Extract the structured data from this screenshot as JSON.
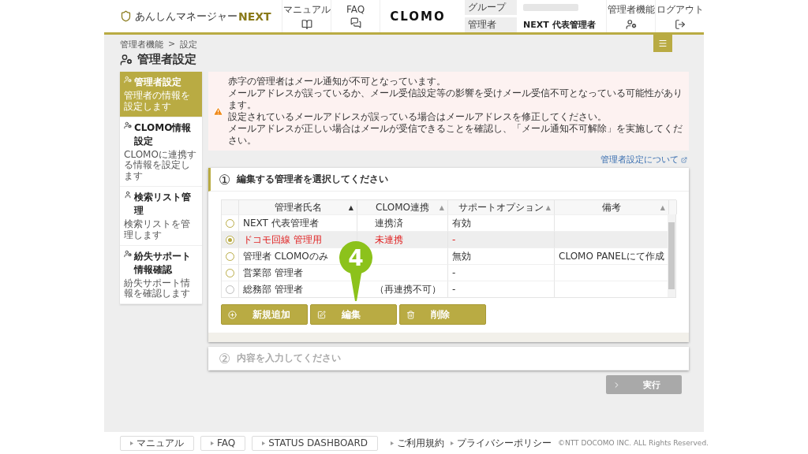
{
  "header": {
    "logo_text": "あんしんマネージャー",
    "logo_accent": "NEXT",
    "nav": [
      {
        "kind": "book",
        "label": "マニュアル"
      },
      {
        "kind": "faq",
        "label": "FAQ"
      }
    ],
    "brand_logo": "CLOMO",
    "account": {
      "group_label": "グループ",
      "admin_label": "管理者",
      "admin_name": "NEXT 代表管理者"
    },
    "actions": [
      {
        "kind": "admin",
        "label": "管理者機能"
      },
      {
        "kind": "logout",
        "label": "ログアウト"
      }
    ]
  },
  "breadcrumb": {
    "items": [
      "管理者機能",
      "設定"
    ],
    "separator": ">"
  },
  "page_title": "管理者設定",
  "sidebar": {
    "items": [
      {
        "kind": "admin",
        "title": "管理者設定",
        "desc": "管理者の情報を設定します",
        "selected": true
      },
      {
        "kind": "admin",
        "title": "CLOMO情報設定",
        "desc": "CLOMOに連携する情報を設定します",
        "selected": false
      },
      {
        "kind": "user",
        "title": "検索リスト管理",
        "desc": "検索リストを管理します",
        "selected": false
      },
      {
        "kind": "admin",
        "title": "紛失サポート情報確認",
        "desc": "紛失サポート情報を確認します",
        "selected": false
      }
    ]
  },
  "alert": {
    "lines": [
      "赤字の管理者はメール通知が不可となっています。",
      "メールアドレスが誤っているか、メール受信設定等の影響を受けメール受信不可となっている可能性があります。",
      "設定されているメールアドレスが誤っている場合はメールアドレスを修正してください。",
      "メールアドレスが正しい場合はメールが受信できることを確認し、「メール通知不可解除」を実施してください。"
    ]
  },
  "help_link": "管理者設定について",
  "step1": {
    "number": "①",
    "title": "編集する管理者を選択してください",
    "table": {
      "columns": [
        {
          "label": "管理者氏名",
          "sort_icon": "▲",
          "sorted": true
        },
        {
          "label": "CLOMO連携",
          "sort_icon": "▲",
          "sorted": false
        },
        {
          "label": "サポートオプション",
          "sort_icon": "▲",
          "sorted": false
        },
        {
          "label": "備考",
          "sort_icon": "▲",
          "sorted": false
        }
      ],
      "rows": [
        {
          "selected": false,
          "error": false,
          "disabled": false,
          "cells": [
            "NEXT 代表管理者",
            "連携済",
            "有効",
            ""
          ]
        },
        {
          "selected": true,
          "error": true,
          "disabled": false,
          "cells": [
            "ドコモ回線 管理用",
            "未連携",
            "-",
            ""
          ]
        },
        {
          "selected": false,
          "error": false,
          "disabled": false,
          "cells": [
            "管理者 CLOMOのみ",
            "",
            "無効",
            "CLOMO PANELにて作成"
          ]
        },
        {
          "selected": false,
          "error": false,
          "disabled": false,
          "cells": [
            "営業部 管理者",
            "",
            "-",
            ""
          ]
        },
        {
          "selected": false,
          "error": false,
          "disabled": true,
          "cells": [
            "総務部 管理者",
            "（再連携不可）",
            "-",
            ""
          ]
        }
      ]
    },
    "buttons": [
      {
        "kind": "add",
        "label": "新規追加"
      },
      {
        "kind": "edit",
        "label": "編集"
      },
      {
        "kind": "delete",
        "label": "削除"
      }
    ],
    "callout": "4"
  },
  "step2": {
    "number": "②",
    "title": "内容を入力してください"
  },
  "run_button": {
    "label": "実行",
    "disabled": true
  },
  "footer": {
    "buttons": [
      "マニュアル",
      "FAQ",
      "STATUS DASHBOARD"
    ],
    "links": [
      "ご利用規約",
      "プライバシーポリシー"
    ],
    "copyright": "©NTT DOCOMO INC. ALL Rights Reserved."
  }
}
